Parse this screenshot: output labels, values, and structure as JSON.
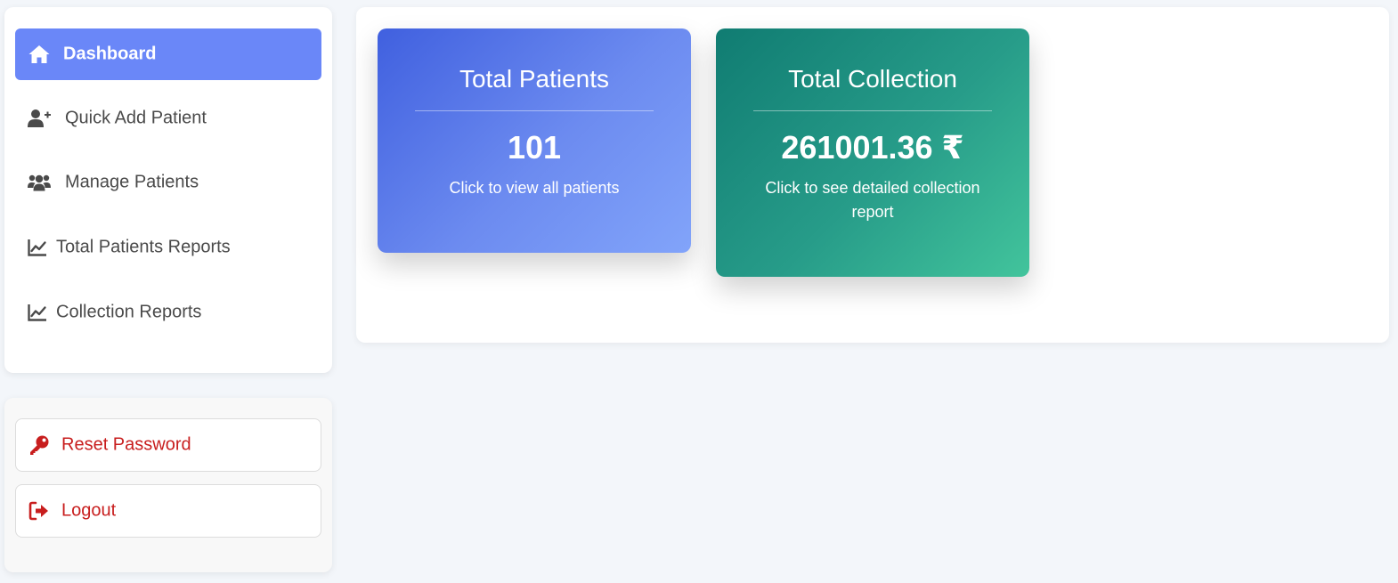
{
  "sidebar": {
    "nav_items": [
      {
        "label": "Dashboard",
        "icon": "home-icon",
        "active": true
      },
      {
        "label": "Quick Add Patient",
        "icon": "user-plus-icon",
        "active": false
      },
      {
        "label": "Manage Patients",
        "icon": "users-icon",
        "active": false
      },
      {
        "label": "Total Patients Reports",
        "icon": "line-chart-icon",
        "active": false
      },
      {
        "label": "Collection Reports",
        "icon": "line-chart-icon",
        "active": false
      }
    ],
    "account": {
      "reset_password_label": "Reset Password",
      "reset_password_icon": "key-icon",
      "logout_label": "Logout",
      "logout_icon": "sign-out-icon"
    }
  },
  "dashboard": {
    "cards": [
      {
        "title": "Total Patients",
        "value": "101",
        "description": "Click to view all patients"
      },
      {
        "title": "Total Collection",
        "value": "261001.36 ₹",
        "description": "Click to see detailed collection report"
      }
    ]
  },
  "colors": {
    "active_nav": "#6a87f8",
    "danger_text": "#c81e1e",
    "patients_card_start": "#4060df",
    "patients_card_end": "#82a4fa",
    "collection_card_start": "#107c72",
    "collection_card_end": "#42c49c"
  }
}
